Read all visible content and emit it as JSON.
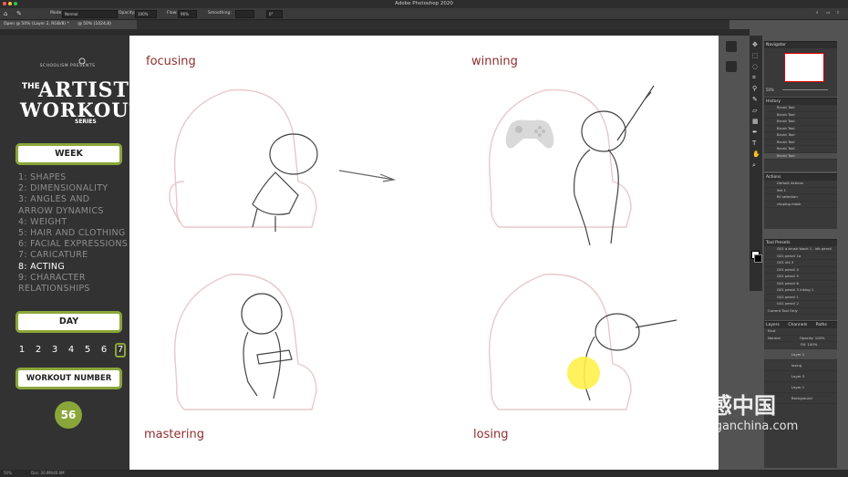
{
  "app": {
    "title": "Adobe Photoshop 2020",
    "doc_tab": "Open @ 50% (Layer 2, RGB/8) *",
    "doc_tab2": "@ 50% (1024,8)"
  },
  "options": {
    "mode_label": "Mode:",
    "mode_value": "Normal",
    "opacity_label": "Opacity:",
    "opacity_value": "100%",
    "flow_label": "Flow:",
    "flow_value": "96%",
    "smoothing_label": "Smoothing:",
    "angle_value": "0°"
  },
  "sidebar": {
    "brand_line": "SCHOOLISM PRESENTS",
    "brand_the": "THE",
    "brand_artist": "ARTIST",
    "brand_workout": "WORKOUT",
    "brand_series": "SERIES",
    "week_label": "WEEK",
    "weeks": [
      "1:   SHAPES",
      "2: DIMENSIONALITY",
      "3: ANGLES AND",
      "     ARROW DYNAMICS",
      "4: WEIGHT",
      "5: HAIR AND CLOTHING",
      "6: FACIAL EXPRESSIONS",
      "7: CARICATURE",
      "8: ACTING",
      "9: CHARACTER",
      "     RELATIONSHIPS"
    ],
    "current_week_index": 8,
    "day_label": "DAY",
    "days": [
      "1",
      "2",
      "3",
      "4",
      "5",
      "6",
      "7"
    ],
    "current_day": "7",
    "workout_label": "WORKOUT NUMBER",
    "workout_number": "56",
    "accent": "#8aa63a"
  },
  "canvas": {
    "labels": {
      "tl": "focusing",
      "tr": "winning",
      "bl": "mastering",
      "br": "losing"
    },
    "label_color": "#8f2e2e"
  },
  "panels": {
    "navigator": "Navigator",
    "navigator_zoom": "50%",
    "history": "History",
    "history_items": [
      "Brush Tool",
      "Brush Tool",
      "Brush Tool",
      "Brush Tool",
      "Brush Tool",
      "Brush Tool",
      "Brush Tool",
      "Brush Tool"
    ],
    "actions": "Actions",
    "actions_items": [
      "Default Actions",
      "Set 1",
      "fill selection",
      "clipping mask"
    ],
    "tool_presets": "Tool Presets",
    "tool_presets_items": [
      "G01 a brush block 1 - idk pencil",
      "G01 pencil 1a",
      "G01 ink 3",
      "G01 pencil 4",
      "G01 pencil 5",
      "G01 pencil 6",
      "G01 pencil 3 inking 1",
      "G01 pencil 1",
      "G01 pencil 2"
    ],
    "current_tool_only": "Current Tool Only",
    "layers_tabs": [
      "Layers",
      "Channels",
      "Paths"
    ],
    "layers_kind": "Kind",
    "layers_blend": "Normal",
    "layers_opacity": "Opacity: 100%",
    "layers_fill": "Fill: 100%",
    "layers": [
      "Layer 2",
      "losing",
      "Layer 3",
      "Layer 1",
      "Background"
    ]
  },
  "status": {
    "zoom": "50%",
    "doc": "Doc: 20.9M/40.6M"
  },
  "watermark": {
    "text": "灵感中国",
    "url": "lingganchina.com"
  }
}
